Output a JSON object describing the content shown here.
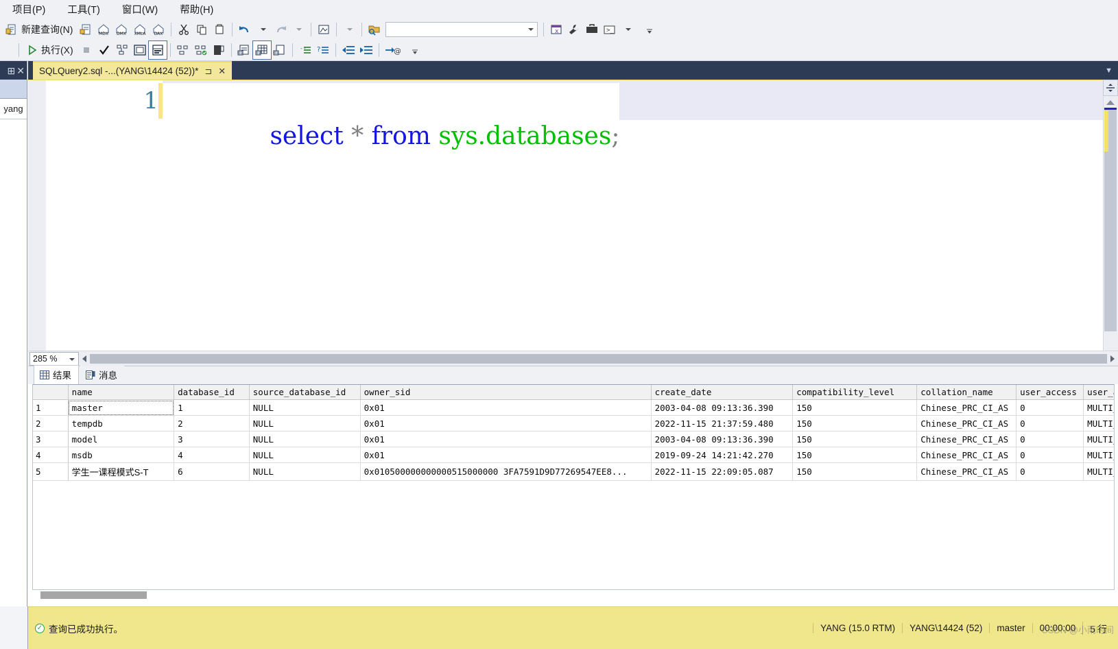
{
  "menu": {
    "items": [
      {
        "label": "项目(P)",
        "name": "menu-project"
      },
      {
        "label": "工具(T)",
        "name": "menu-tools"
      },
      {
        "label": "窗口(W)",
        "name": "menu-window"
      },
      {
        "label": "帮助(H)",
        "name": "menu-help"
      }
    ]
  },
  "toolbar1": {
    "new_query_label": "新建查询(N)",
    "combo_value": "",
    "icons": [
      "new-query-icon",
      "new-mdx-query-icon",
      "new-dmx-query-icon",
      "new-xmla-query-icon",
      "new-dax-query-icon",
      "cut-icon",
      "copy-icon",
      "paste-icon",
      "undo-icon",
      "redo-icon",
      "find-in-files-icon",
      "open-file-icon",
      "quick-launch-combo",
      "toolbox-icon",
      "options-icon",
      "properties-icon",
      "command-prompt-icon"
    ]
  },
  "toolbar2": {
    "execute_label": "执行(X)",
    "icons": [
      "execute-icon",
      "stop-icon",
      "parse-check-icon",
      "display-estimated-plan-icon",
      "include-actual-plan-icon",
      "include-client-statistics-icon",
      "results-to-text-icon",
      "results-to-grid-icon",
      "results-to-file-icon",
      "comment-icon",
      "uncomment-icon",
      "decrease-indent-icon",
      "increase-indent-icon",
      "specify-values-icon"
    ]
  },
  "left_dock": {
    "pin_icon": "pin-icon",
    "close_icon": "close-icon",
    "tab_label": "yang"
  },
  "document_tab": {
    "title": "SQLQuery2.sql -...(YANG\\14424 (52))*",
    "pin_glyph": "⊐",
    "close_glyph": "✕"
  },
  "editor": {
    "line_number": "1",
    "code": {
      "kw_select": "select",
      "op_star": "*",
      "kw_from": "from",
      "obj_schema": "sys",
      "obj_dot": ".",
      "obj_table": "databases",
      "punc_semi": ";"
    },
    "zoom_level": "285 %"
  },
  "results": {
    "tabs": [
      {
        "label": "结果",
        "icon": "grid-icon",
        "active": true
      },
      {
        "label": "消息",
        "icon": "message-icon",
        "active": false
      }
    ],
    "columns": [
      "name",
      "database_id",
      "source_database_id",
      "owner_sid",
      "create_date",
      "compatibility_level",
      "collation_name",
      "user_access",
      "user_acc"
    ],
    "rows": [
      {
        "num": "1",
        "name": "master",
        "database_id": "1",
        "source_database_id": "NULL",
        "owner_sid": "0x01",
        "create_date": "2003-04-08 09:13:36.390",
        "compatibility_level": "150",
        "collation_name": "Chinese_PRC_CI_AS",
        "user_access": "0",
        "user_access_desc": "MULTI_US"
      },
      {
        "num": "2",
        "name": " tempdb",
        "database_id": "2",
        "source_database_id": "NULL",
        "owner_sid": "0x01",
        "create_date": "2022-11-15 21:37:59.480",
        "compatibility_level": "150",
        "collation_name": "Chinese_PRC_CI_AS",
        "user_access": "0",
        "user_access_desc": "MULTI_US"
      },
      {
        "num": "3",
        "name": "model",
        "database_id": "3",
        "source_database_id": "NULL",
        "owner_sid": "0x01",
        "create_date": "2003-04-08 09:13:36.390",
        "compatibility_level": "150",
        "collation_name": "Chinese_PRC_CI_AS",
        "user_access": "0",
        "user_access_desc": "MULTI_US"
      },
      {
        "num": "4",
        "name": "msdb",
        "database_id": "4",
        "source_database_id": "NULL",
        "owner_sid": "0x01",
        "create_date": "2019-09-24 14:21:42.270",
        "compatibility_level": "150",
        "collation_name": "Chinese_PRC_CI_AS",
        "user_access": "0",
        "user_access_desc": "MULTI_US"
      },
      {
        "num": "5",
        "name": "学生一课程模式S-T",
        "database_id": "6",
        "source_database_id": "NULL",
        "owner_sid": "0x010500000000000515000000 3FA7591D9D77269547EE8...",
        "create_date": "2022-11-15 22:09:05.087",
        "compatibility_level": "150",
        "collation_name": "Chinese_PRC_CI_AS",
        "user_access": "0",
        "user_access_desc": "MULTI_US"
      }
    ]
  },
  "statusbar": {
    "message": "查询已成功执行。",
    "server": "YANG (15.0 RTM)",
    "user": "YANG\\14424 (52)",
    "database": "master",
    "elapsed": "00:00:00",
    "rows": "5 行",
    "watermark": "CSDN @小雨时间"
  },
  "colors": {
    "tab_active": "#f2e79b",
    "status_bg": "#f0e68c",
    "keyword": "#1515e0",
    "object": "#00c000",
    "dock": "#2d3b55"
  }
}
